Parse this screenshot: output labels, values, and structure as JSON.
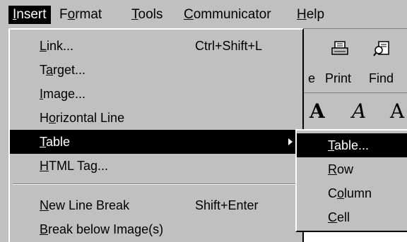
{
  "menubar": {
    "items": [
      {
        "label": "Insert"
      },
      {
        "label": "Format"
      },
      {
        "label": "Tools"
      },
      {
        "label": "Communicator"
      },
      {
        "label": "Help"
      }
    ]
  },
  "toolbar": {
    "buttons": [
      {
        "label": "e",
        "icon": "publish-icon"
      },
      {
        "label": "Print",
        "icon": "printer-icon"
      },
      {
        "label": "Find",
        "icon": "find-icon"
      }
    ]
  },
  "format_bar": {
    "buttons": [
      {
        "label": "A",
        "icon": "bold-icon"
      },
      {
        "label": "A",
        "icon": "italic-icon"
      },
      {
        "label": "A",
        "icon": "fixed-width-icon"
      }
    ]
  },
  "insert_menu": {
    "items": [
      {
        "label": "Link...",
        "shortcut": "Ctrl+Shift+L"
      },
      {
        "label": "Target..."
      },
      {
        "label": "Image..."
      },
      {
        "label": "Horizontal Line"
      },
      {
        "label": "Table",
        "selected": true,
        "has_submenu": true
      },
      {
        "label": "HTML Tag..."
      },
      {
        "label": "New Line Break",
        "shortcut": "Shift+Enter"
      },
      {
        "label": "Break below Image(s)"
      }
    ]
  },
  "table_submenu": {
    "items": [
      {
        "label": "Table...",
        "selected": true
      },
      {
        "label": "Row"
      },
      {
        "label": "Column"
      },
      {
        "label": "Cell"
      }
    ]
  },
  "colors": {
    "face": "#c0c0c0",
    "highlight": "#000000",
    "highlight_text": "#ffffff",
    "shadow": "#808080"
  }
}
